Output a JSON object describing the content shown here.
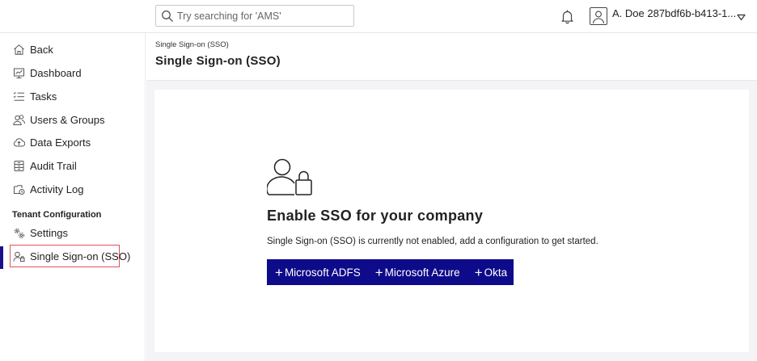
{
  "search": {
    "placeholder": "Try searching for 'AMS'"
  },
  "user": {
    "name": "A. Doe 287bdf6b-b413-1..."
  },
  "sidebar": {
    "items": [
      {
        "label": "Back",
        "icon": "home-icon"
      },
      {
        "label": "Dashboard",
        "icon": "dashboard-icon"
      },
      {
        "label": "Tasks",
        "icon": "tasks-icon"
      },
      {
        "label": "Users & Groups",
        "icon": "users-icon"
      },
      {
        "label": "Data Exports",
        "icon": "cloud-upload-icon"
      },
      {
        "label": "Audit Trail",
        "icon": "audit-icon"
      },
      {
        "label": "Activity Log",
        "icon": "activity-icon"
      }
    ],
    "section_title": "Tenant Configuration",
    "config_items": [
      {
        "label": "Settings",
        "icon": "gears-icon"
      },
      {
        "label": "Single Sign-on (SSO)",
        "icon": "user-lock-icon"
      }
    ]
  },
  "main": {
    "breadcrumb": "Single Sign-on (SSO)",
    "title": "Single Sign-on (SSO)",
    "hero": {
      "title": "Enable SSO for your company",
      "description": "Single Sign-on (SSO) is currently not enabled, add a configuration to get started."
    },
    "buttons": [
      {
        "label": "Microsoft ADFS"
      },
      {
        "label": "Microsoft Azure"
      },
      {
        "label": "Okta"
      }
    ]
  },
  "colors": {
    "accent": "#0e0b8a",
    "highlight_border": "#e0525e",
    "background": "#f4f4f6"
  }
}
